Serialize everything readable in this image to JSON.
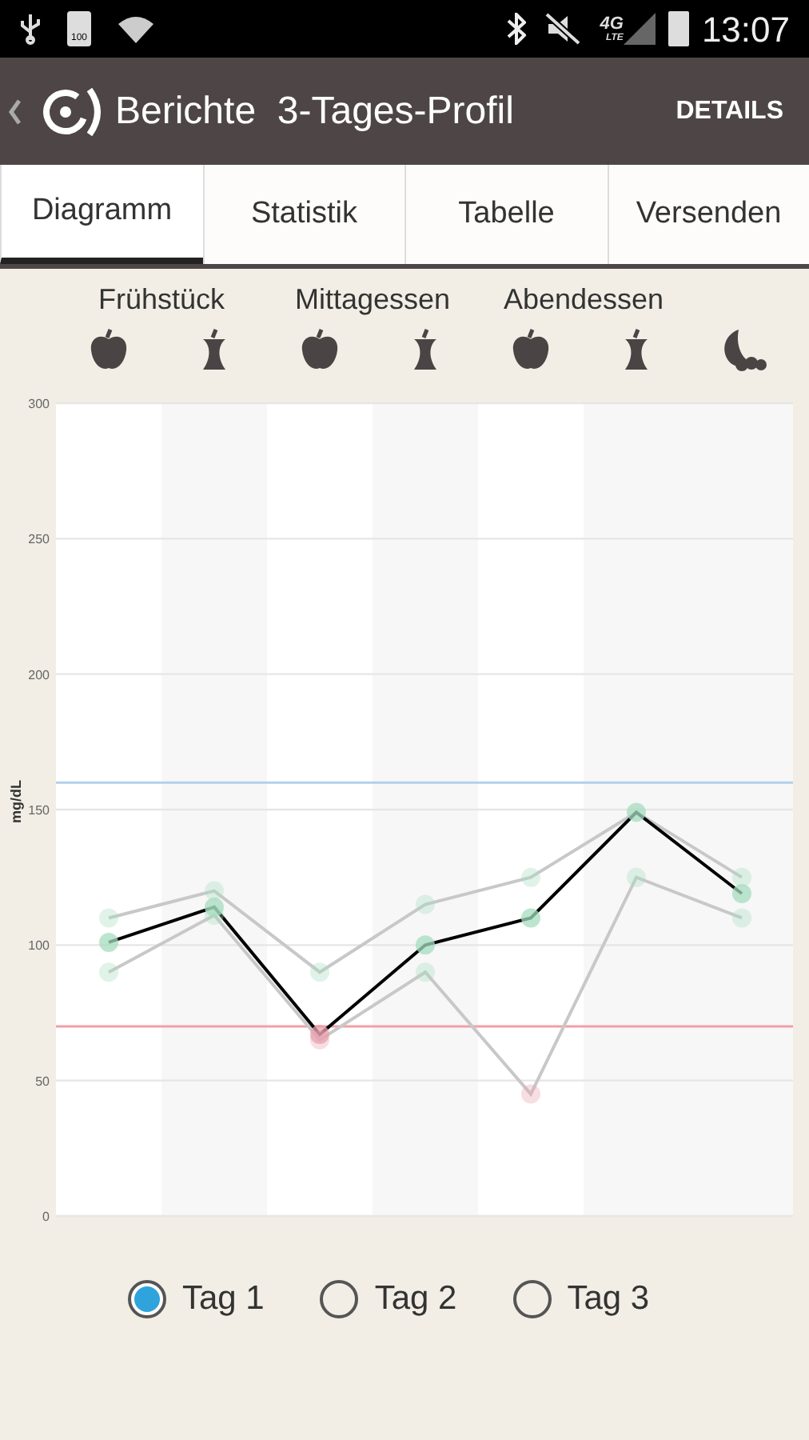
{
  "status_bar": {
    "battery_level_text": "100",
    "network": "4G",
    "network_sub": "LTE",
    "time": "13:07"
  },
  "app_bar": {
    "title": "Berichte  3-Tages-Profil",
    "action": "DETAILS"
  },
  "tabs": [
    {
      "label": "Diagramm",
      "selected": true
    },
    {
      "label": "Statistik",
      "selected": false
    },
    {
      "label": "Tabelle",
      "selected": false
    },
    {
      "label": "Versenden",
      "selected": false
    }
  ],
  "meals": [
    "Frühstück",
    "Mittagessen",
    "Abendessen"
  ],
  "time_slots": [
    {
      "kind": "before"
    },
    {
      "kind": "after"
    },
    {
      "kind": "before"
    },
    {
      "kind": "after"
    },
    {
      "kind": "before"
    },
    {
      "kind": "after"
    },
    {
      "kind": "night"
    }
  ],
  "chart_data": {
    "type": "line",
    "grid": true,
    "ylabel": "mg/dL",
    "ylim": [
      0,
      300
    ],
    "yticks": [
      0,
      50,
      100,
      150,
      200,
      250,
      300
    ],
    "series": [
      {
        "name": "Tag 1",
        "color": "#000000",
        "marker": "circle",
        "values": [
          101,
          114,
          67,
          100,
          110,
          149,
          119
        ]
      },
      {
        "name": "Tag 2",
        "color": "#c8c8c8",
        "marker": "circle",
        "values": [
          110,
          120,
          90,
          115,
          125,
          149,
          125
        ]
      },
      {
        "name": "Tag 3",
        "color": "#c8c8c8",
        "marker": "circle",
        "values": [
          90,
          111,
          65,
          90,
          45,
          125,
          110
        ]
      }
    ],
    "ref_lines": [
      {
        "axis": "y",
        "value": 160,
        "color": "#b3d1ea"
      },
      {
        "axis": "y",
        "value": 70,
        "color": "#f0a0a8"
      }
    ]
  },
  "days": [
    {
      "selected": true
    },
    {
      "selected": false
    },
    {
      "selected": false
    }
  ]
}
